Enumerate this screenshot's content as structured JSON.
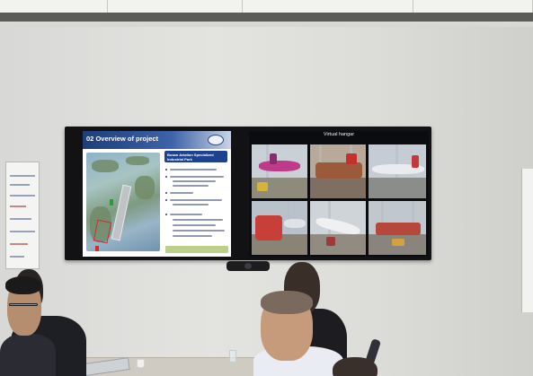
{
  "scene": {
    "description_free": true
  },
  "slide": {
    "number": "02",
    "title": "Overview of project",
    "callout": "Busan Aviation Specialized Industrial Park"
  },
  "camwall": {
    "title": "Virtual hangar"
  },
  "colors": {
    "wall": "#dcdcd8",
    "tv_frame": "#121214",
    "slide_header": "#1f3d79",
    "callout": "#1d4390",
    "label_green": "#2e9a3c",
    "label_red": "#d42c2c"
  }
}
